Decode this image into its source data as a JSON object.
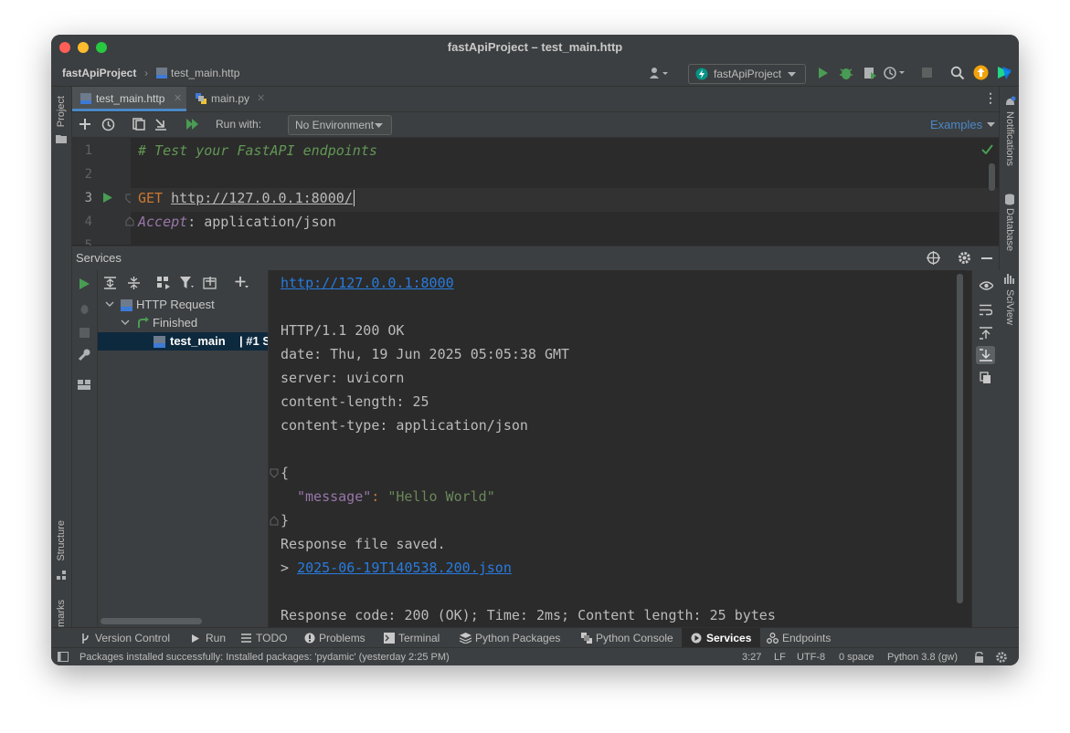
{
  "window": {
    "title": "fastApiProject – test_main.http"
  },
  "navbar": {
    "project": "fastApiProject",
    "file": "test_main.http",
    "run_config": "fastApiProject"
  },
  "tabs": [
    {
      "label": "test_main.http",
      "active": true
    },
    {
      "label": "main.py",
      "active": false
    }
  ],
  "toolbar": {
    "run_with_label": "Run with:",
    "environment": "No Environment",
    "examples_label": "Examples"
  },
  "editor": {
    "line_numbers": [
      "1",
      "2",
      "3",
      "4",
      "5"
    ],
    "comment": "# Test your FastAPI endpoints",
    "method": "GET",
    "url": "http://127.0.0.1:8000/",
    "header_name": "Accept",
    "header_value": "application/json"
  },
  "services": {
    "title": "Services",
    "tree": {
      "root": "HTTP Request",
      "finished": "Finished",
      "item_name": "test_main",
      "item_suffix": "| #1 S"
    }
  },
  "response": {
    "url": "http://127.0.0.1:8000",
    "status": "HTTP/1.1 200 OK",
    "headers": [
      "date: Thu, 19 Jun 2025 05:05:38 GMT",
      "server: uvicorn",
      "content-length: 25",
      "content-type: application/json"
    ],
    "open_brace": "{",
    "json_key": "\"message\"",
    "json_colon": ": ",
    "json_value": "\"Hello World\"",
    "close_brace": "}",
    "saved": "Response file saved.",
    "file_prefix": "> ",
    "file_link": "2025-06-19T140538.200.json",
    "summary": "Response code: 200 (OK); Time: 2ms; Content length: 25 bytes"
  },
  "side_tools": {
    "left": {
      "project": "Project",
      "structure": "Structure",
      "bookmarks": "Bookmarks"
    },
    "right": {
      "notifications": "Notifications",
      "database": "Database",
      "sciview": "SciView"
    }
  },
  "bottom_tabs": [
    "Version Control",
    "Run",
    "TODO",
    "Problems",
    "Terminal",
    "Python Packages",
    "Python Console",
    "Services",
    "Endpoints"
  ],
  "status_bar": {
    "message": "Packages installed successfully: Installed packages: 'pydamic' (yesterday 2:25 PM)",
    "position": "3:27",
    "line_sep": "LF",
    "encoding": "UTF-8",
    "indent": "0 space",
    "interpreter": "Python 3.8 (gw)"
  },
  "colors": {
    "accent": "#4a88c7",
    "comment": "#629755",
    "keyword": "#cc7832",
    "string": "#6a8759",
    "link": "#287bde",
    "run_green": "#499c54"
  }
}
